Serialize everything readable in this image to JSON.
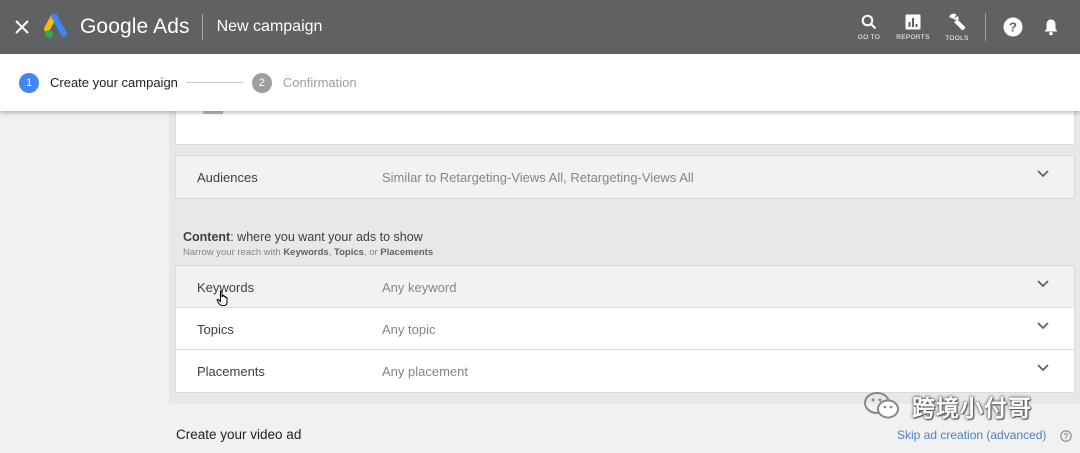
{
  "header": {
    "close_icon": "close-icon",
    "brand": "Google Ads",
    "title": "New campaign",
    "tools": [
      {
        "label": "GO TO",
        "icon": "search-icon"
      },
      {
        "label": "REPORTS",
        "icon": "reports-icon"
      },
      {
        "label": "TOOLS",
        "icon": "wrench-icon"
      }
    ],
    "help_icon": "help-icon",
    "notifications_icon": "bell-icon",
    "bar_color": "#5f6163"
  },
  "stepper": {
    "steps": [
      {
        "number": "1",
        "label": "Create your campaign",
        "state": "active"
      },
      {
        "number": "2",
        "label": "Confirmation",
        "state": "inactive"
      }
    ],
    "active_color": "#4285f4"
  },
  "audiences": {
    "label": "Audiences",
    "value": "Similar to Retargeting-Views All, Retargeting-Views All"
  },
  "content": {
    "heading_bold": "Content",
    "heading_rest": ": where you want your ads to show",
    "sub_prefix": "Narrow your reach with ",
    "sub_keywords": "Keywords",
    "sub_sep1": ", ",
    "sub_topics": "Topics",
    "sub_sep2": ", or ",
    "sub_placements": "Placements",
    "rows": [
      {
        "label": "Keywords",
        "value": "Any keyword"
      },
      {
        "label": "Topics",
        "value": "Any topic"
      },
      {
        "label": "Placements",
        "value": "Any placement"
      }
    ]
  },
  "video": {
    "title": "Create your video ad",
    "skip_link": "Skip ad creation (advanced)"
  },
  "watermark": {
    "text": "跨境小付哥",
    "icon": "wechat-icon"
  }
}
